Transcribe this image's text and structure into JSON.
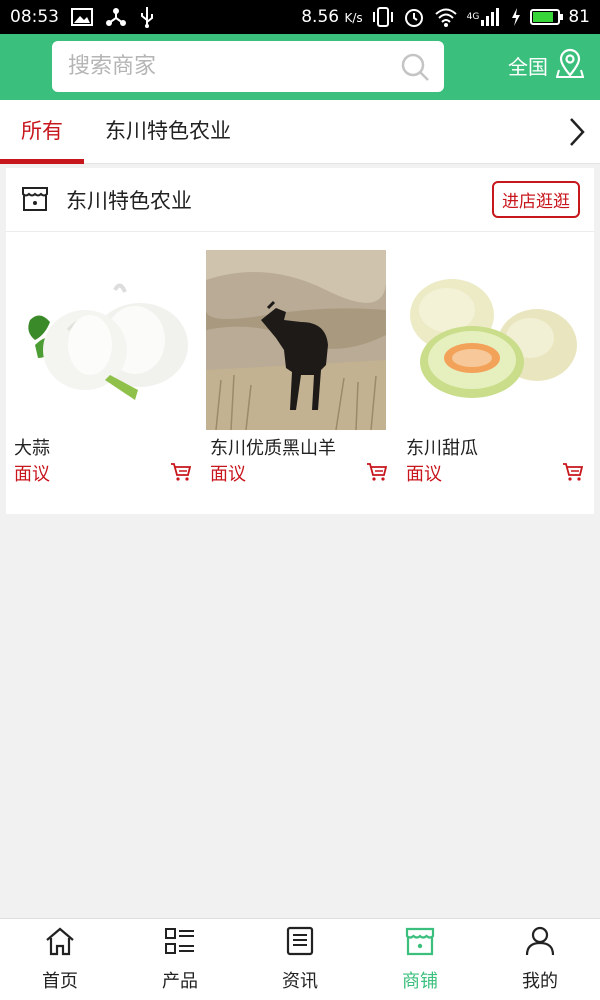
{
  "status_bar": {
    "time": "08:53",
    "network_speed": "8.56",
    "speed_unit": "K/s",
    "signal_type": "4G",
    "battery_level": "81"
  },
  "header": {
    "search_placeholder": "搜索商家",
    "region_label": "全国",
    "background_color": "#3bbf7c"
  },
  "tabs": {
    "items": [
      {
        "label": "所有",
        "active": true
      },
      {
        "label": "东川特色农业",
        "active": false
      }
    ],
    "accent_color": "#c8161d"
  },
  "shop": {
    "name": "东川特色农业",
    "enter_label": "进店逛逛",
    "products": [
      {
        "name": "大蒜",
        "price": "面议"
      },
      {
        "name": "东川优质黑山羊",
        "price": "面议"
      },
      {
        "name": "东川甜瓜",
        "price": "面议"
      }
    ]
  },
  "bottom_nav": {
    "items": [
      {
        "label": "首页",
        "icon": "home-icon"
      },
      {
        "label": "产品",
        "icon": "list-icon"
      },
      {
        "label": "资讯",
        "icon": "news-icon"
      },
      {
        "label": "商铺",
        "icon": "store-icon",
        "active": true
      },
      {
        "label": "我的",
        "icon": "person-icon"
      }
    ]
  }
}
